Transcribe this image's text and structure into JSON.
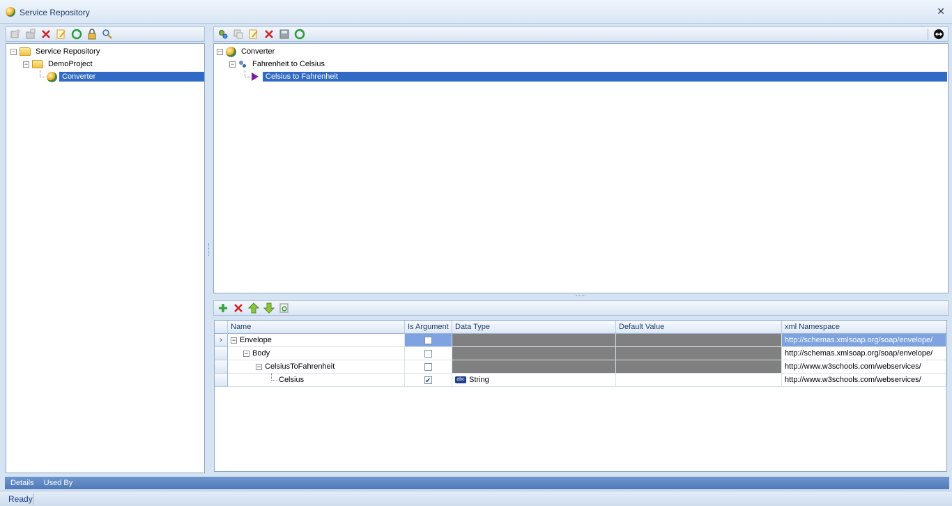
{
  "window": {
    "title": "Service Repository"
  },
  "left_tree": {
    "root": "Service Repository",
    "project": "DemoProject",
    "service": "Converter"
  },
  "right_tree": {
    "root": "Converter",
    "operation1": "Fahrenheit to Celsius",
    "operation2": "Celsius to Fahrenheit"
  },
  "grid": {
    "columns": [
      "Name",
      "Is Argument",
      "Data Type",
      "Default Value",
      "xml Namespace"
    ],
    "rows": [
      {
        "name": "Envelope",
        "is_argument": false,
        "data_type": "",
        "default_value": "",
        "namespace": "http://schemas.xmlsoap.org/soap/envelope/"
      },
      {
        "name": "Body",
        "is_argument": false,
        "data_type": "",
        "default_value": "",
        "namespace": "http://schemas.xmlsoap.org/soap/envelope/"
      },
      {
        "name": "CelsiusToFahrenheit",
        "is_argument": false,
        "data_type": "",
        "default_value": "",
        "namespace": "http://www.w3schools.com/webservices/"
      },
      {
        "name": "Celsius",
        "is_argument": true,
        "data_type": "String",
        "default_value": "",
        "namespace": "http://www.w3schools.com/webservices/"
      }
    ],
    "row_indicator": "›",
    "abc_label": "abc"
  },
  "tabs": [
    "Details",
    "Used By"
  ],
  "status": {
    "text": "Ready"
  },
  "icons": {
    "close": "close-icon",
    "nav": "nav-arrow-icon"
  },
  "colors": {
    "selection": "#316ac5",
    "gray_cell": "#808080"
  }
}
